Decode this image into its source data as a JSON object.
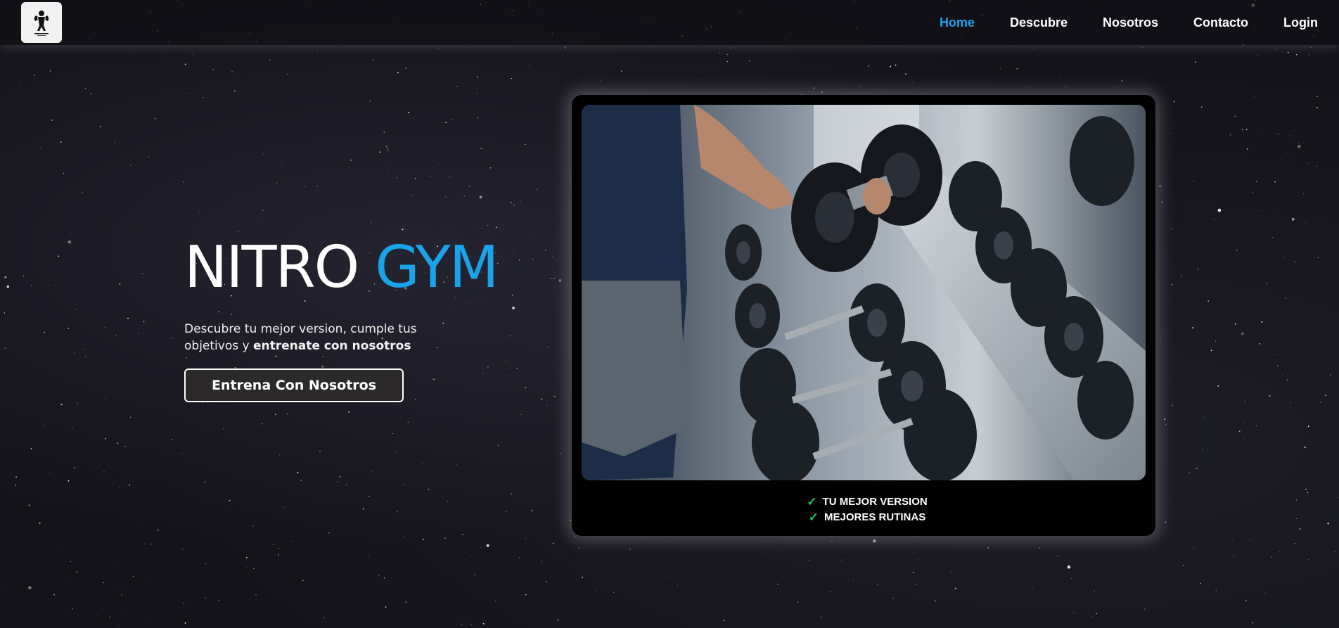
{
  "header": {
    "logo_icon": "bodybuilder-logo-icon",
    "nav": [
      {
        "label": "Home",
        "active": true
      },
      {
        "label": "Descubre",
        "active": false
      },
      {
        "label": "Nosotros",
        "active": false
      },
      {
        "label": "Contacto",
        "active": false
      },
      {
        "label": "Login",
        "active": false
      }
    ]
  },
  "hero": {
    "title_main": "NITRO",
    "title_accent": "GYM",
    "description_start": "Descubre tu mejor version, cumple tus objetivos y",
    "description_bold": "entrenate con nosotros",
    "cta_label": "Entrena Con Nosotros"
  },
  "card": {
    "image_subject": "dumbbell-rack-photo",
    "features": [
      {
        "icon": "check-icon",
        "label": "TU MEJOR VERSION"
      },
      {
        "icon": "check-icon",
        "label": "MEJORES RUTINAS"
      }
    ]
  },
  "colors": {
    "accent": "#1aa3e8",
    "background": "#14131a",
    "check": "#22c55e",
    "button_bg": "#2b292a"
  }
}
